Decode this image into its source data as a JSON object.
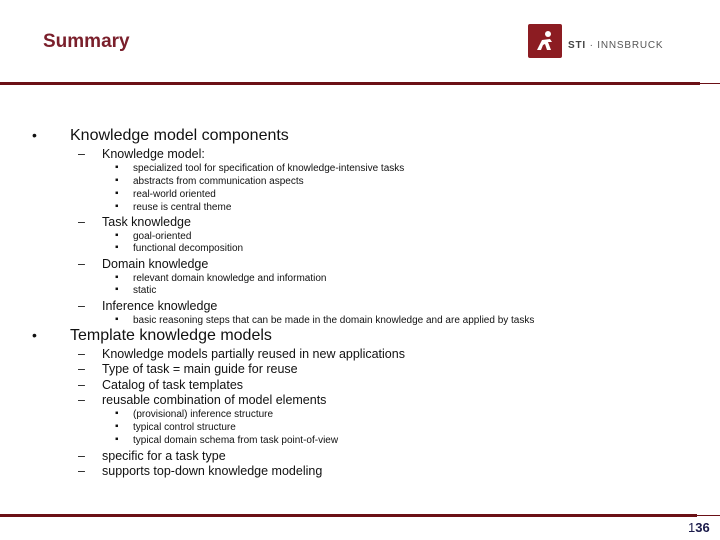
{
  "header": {
    "title": "Summary",
    "logo": {
      "icon": "sti-runner-icon",
      "brand_bold": "STI",
      "separator": "·",
      "brand_rest": "INNSBRUCK",
      "color": "#8c1c22"
    }
  },
  "markers": {
    "level1": "•",
    "level2": "–",
    "level3": "▪"
  },
  "body": {
    "sections": [
      {
        "label": "Knowledge model components",
        "items": [
          {
            "label": "Knowledge model:",
            "subitems": [
              "specialized tool for specification of knowledge-intensive tasks",
              "abstracts from communication aspects",
              "real-world oriented",
              "reuse is central theme"
            ]
          },
          {
            "label": "Task knowledge",
            "subitems": [
              "goal-oriented",
              "functional decomposition"
            ]
          },
          {
            "label": "Domain knowledge",
            "subitems": [
              "relevant domain knowledge and information",
              "static"
            ]
          },
          {
            "label": "Inference knowledge",
            "subitems": [
              "basic reasoning steps that can be made in the domain knowledge and are applied by tasks"
            ]
          }
        ]
      },
      {
        "label": "Template knowledge models",
        "items": [
          {
            "label": "Knowledge models partially reused in new applications",
            "subitems": []
          },
          {
            "label": "Type of task = main guide for reuse",
            "subitems": []
          },
          {
            "label": "Catalog of task templates",
            "subitems": []
          },
          {
            "label": "reusable combination of model elements",
            "subitems": [
              "(provisional) inference structure",
              "typical control structure",
              "typical domain schema from task point-of-view"
            ]
          },
          {
            "label": "specific for a task type",
            "subitems": []
          },
          {
            "label": "supports top-down knowledge modeling",
            "subitems": []
          }
        ]
      }
    ]
  },
  "footer": {
    "page_prefix": "1",
    "page_number": "36"
  },
  "colors": {
    "title": "#7a1f2b",
    "rule": "#6b1016",
    "logo_bg": "#8c1c22"
  }
}
